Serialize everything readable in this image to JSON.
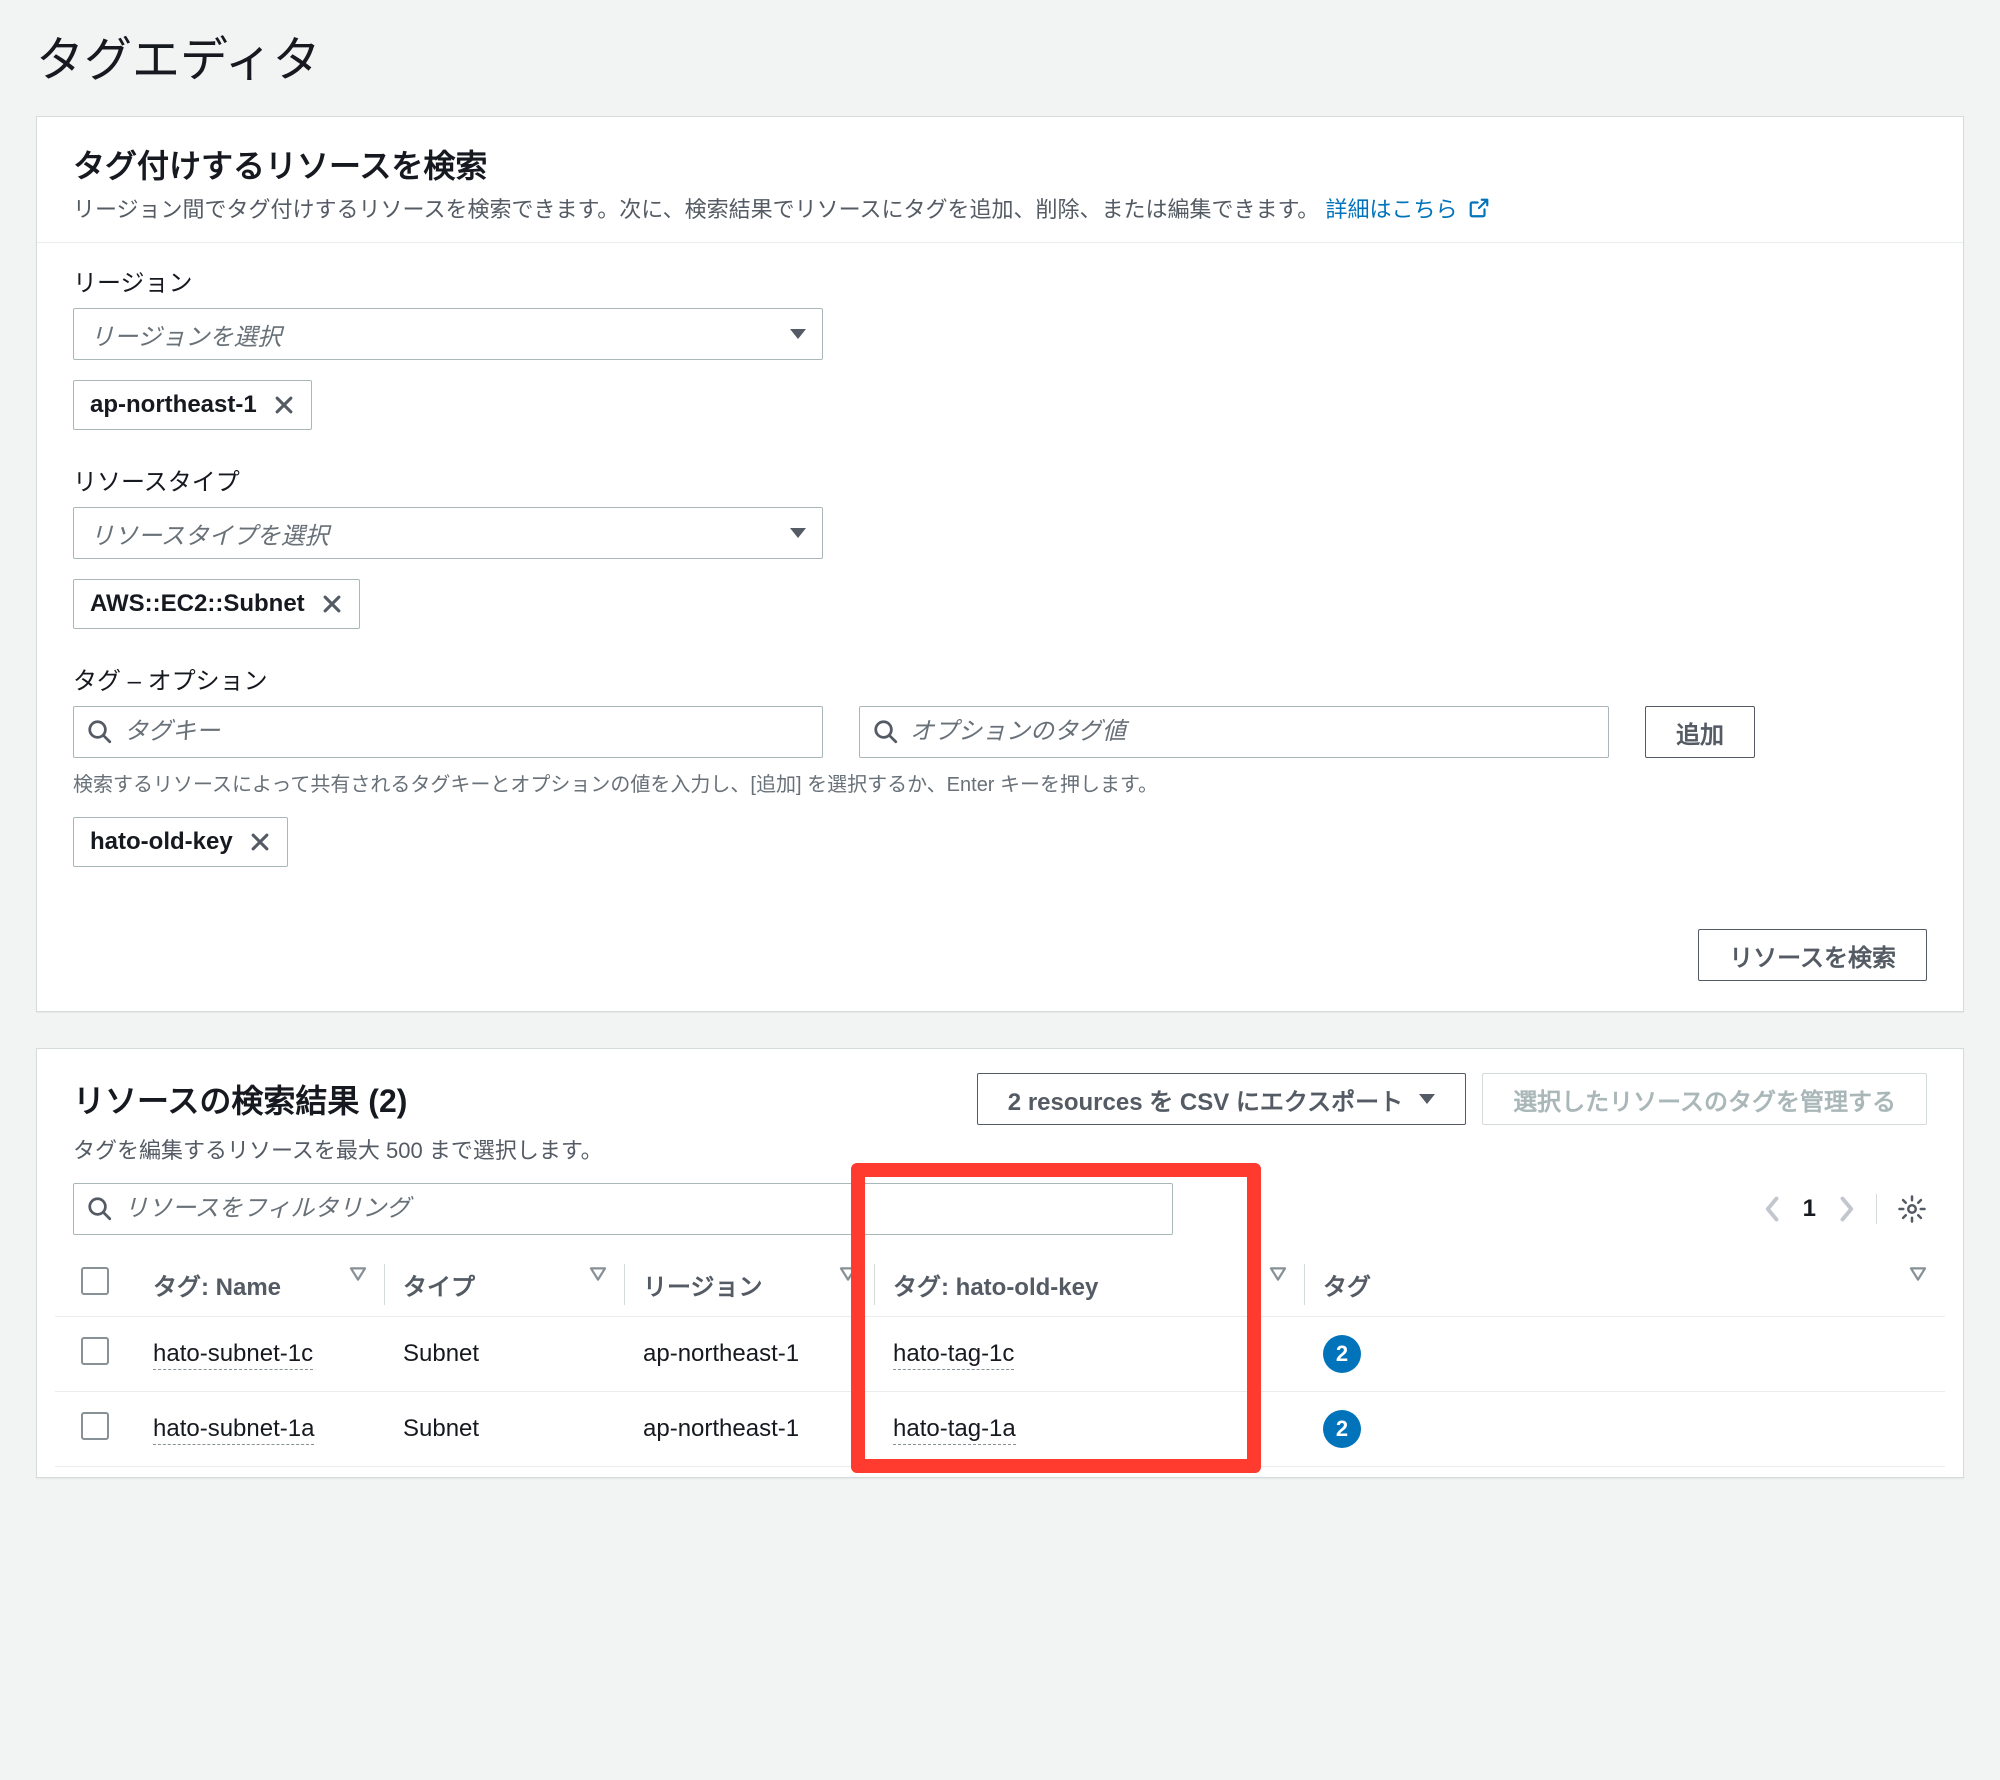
{
  "page_title": "タグエディタ",
  "search_panel": {
    "title": "タグ付けするリソースを検索",
    "description": "リージョン間でタグ付けするリソースを検索できます。次に、検索結果でリソースにタグを追加、削除、または編集できます。",
    "learn_more": "詳細はこちら",
    "region": {
      "label": "リージョン",
      "placeholder": "リージョンを選択",
      "chip": "ap-northeast-1"
    },
    "resource_type": {
      "label": "リソースタイプ",
      "placeholder": "リソースタイプを選択",
      "chip": "AWS::EC2::Subnet"
    },
    "tags": {
      "label": "タグ – オプション",
      "key_placeholder": "タグキー",
      "value_placeholder": "オプションのタグ値",
      "add_button": "追加",
      "hint": "検索するリソースによって共有されるタグキーとオプションの値を入力し、[追加] を選択するか、Enter キーを押します。",
      "chip": "hato-old-key"
    },
    "search_button": "リソースを検索"
  },
  "results_panel": {
    "title": "リソースの検索結果 (2)",
    "export_button": "2 resources を CSV にエクスポート",
    "manage_button": "選択したリソースのタグを管理する",
    "description": "タグを編集するリソースを最大 500 まで選択します。",
    "filter_placeholder": "リソースをフィルタリング",
    "page": "1",
    "columns": {
      "name": "タグ: Name",
      "type": "タイプ",
      "region": "リージョン",
      "tag_key": "タグ: hato-old-key",
      "tags": "タグ"
    },
    "rows": [
      {
        "name": "hato-subnet-1c",
        "type": "Subnet",
        "region": "ap-northeast-1",
        "tag_key": "hato-tag-1c",
        "tags": "2"
      },
      {
        "name": "hato-subnet-1a",
        "type": "Subnet",
        "region": "ap-northeast-1",
        "tag_key": "hato-tag-1a",
        "tags": "2"
      }
    ]
  }
}
